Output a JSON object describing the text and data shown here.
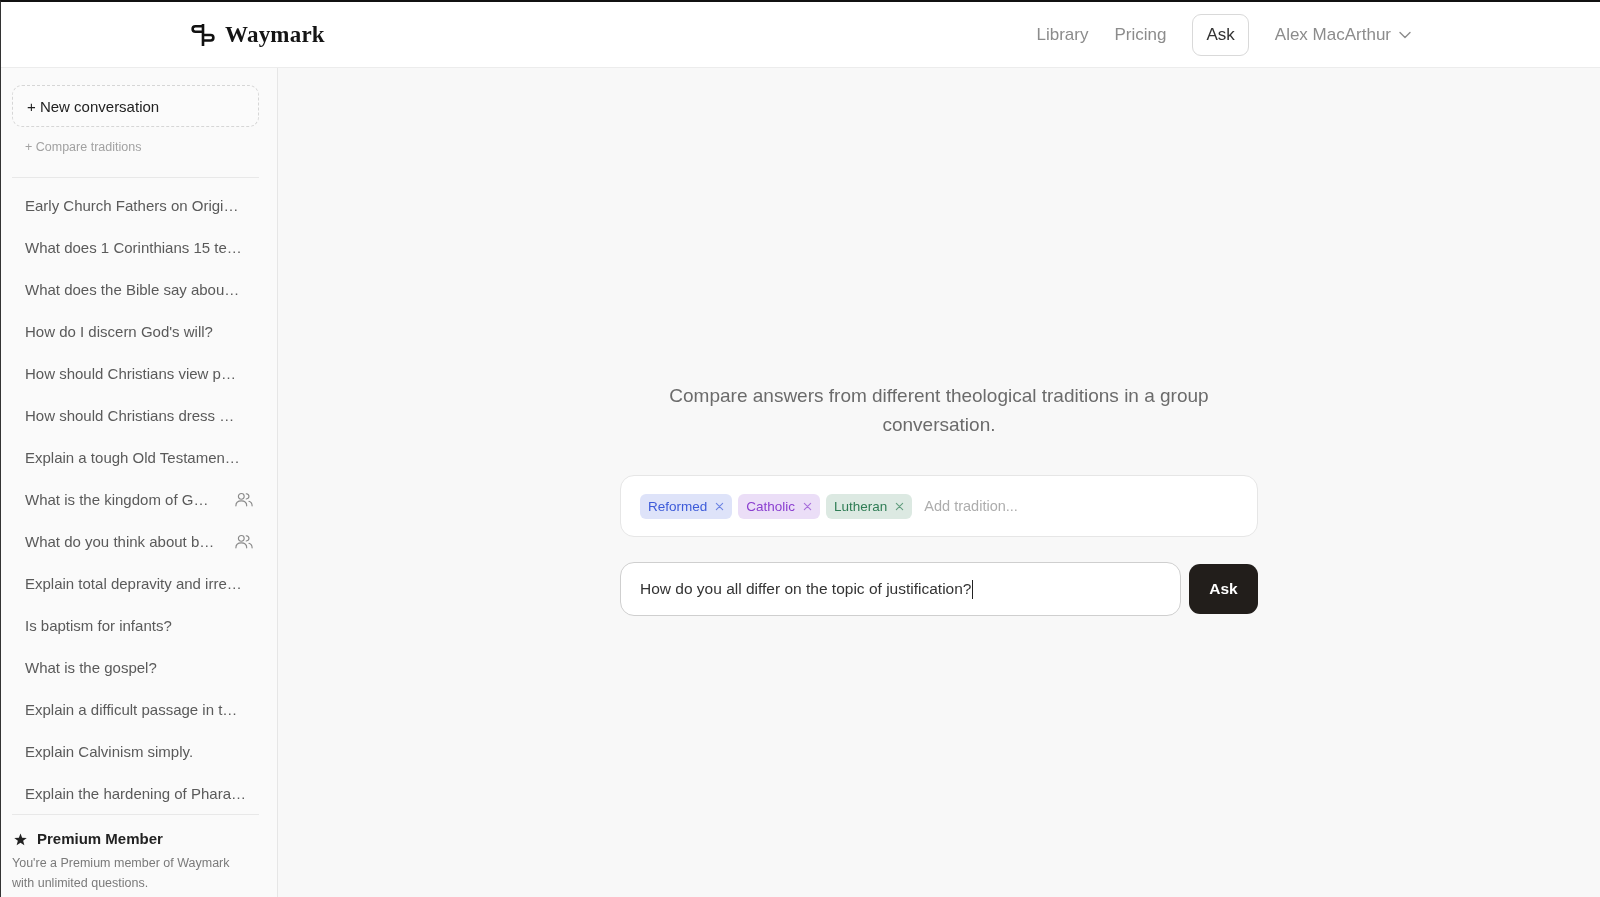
{
  "header": {
    "brand": "Waymark",
    "nav": [
      {
        "label": "Library",
        "selected": false
      },
      {
        "label": "Pricing",
        "selected": false
      },
      {
        "label": "Ask",
        "selected": true
      }
    ],
    "user": "Alex MacArthur"
  },
  "sidebar": {
    "new_conversation": "+ New conversation",
    "compare_traditions": "+ Compare traditions",
    "conversations": [
      {
        "title": "Early Church Fathers on Origi…",
        "group": false
      },
      {
        "title": "What does 1 Corinthians 15 te…",
        "group": false
      },
      {
        "title": "What does the Bible say abou…",
        "group": false
      },
      {
        "title": "How do I discern God's will?",
        "group": false
      },
      {
        "title": "How should Christians view p…",
        "group": false
      },
      {
        "title": "How should Christians dress …",
        "group": false
      },
      {
        "title": "Explain a tough Old Testamen…",
        "group": false
      },
      {
        "title": "What is the kingdom of G…",
        "group": true
      },
      {
        "title": "What do you think about b…",
        "group": true
      },
      {
        "title": "Explain total depravity and irre…",
        "group": false
      },
      {
        "title": "Is baptism for infants?",
        "group": false
      },
      {
        "title": "What is the gospel?",
        "group": false
      },
      {
        "title": "Explain a difficult passage in t…",
        "group": false
      },
      {
        "title": "Explain Calvinism simply.",
        "group": false
      },
      {
        "title": "Explain the hardening of Phara…",
        "group": false
      }
    ],
    "premium": {
      "title": "Premium Member",
      "text": "You're a Premium member of Waymark with unlimited questions."
    }
  },
  "main": {
    "intro": "Compare answers from different theological traditions in a group conversation.",
    "traditions": [
      {
        "label": "Reformed",
        "color": "#3d5bd9"
      },
      {
        "label": "Catholic",
        "color": "#8b3fd0"
      },
      {
        "label": "Lutheran",
        "color": "#2f7d55"
      }
    ],
    "tradition_input": {
      "placeholder": "Add tradition..."
    },
    "question": {
      "value": "How do you all differ on the topic of justification?",
      "focused": true
    },
    "ask_button": "Ask"
  }
}
